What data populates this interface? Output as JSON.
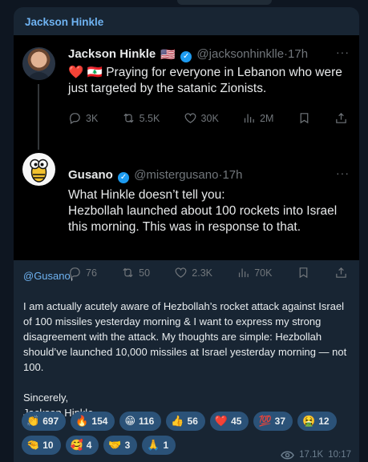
{
  "message": {
    "author": "Jackson Hinkle",
    "tweets": [
      {
        "name": "Jackson Hinkle",
        "flag": "🇺🇸",
        "handle": "@jacksonhinklle",
        "dot": "·",
        "time": "17h",
        "text": "❤️ 🇱🇧 Praying for everyone in Lebanon who were just targeted by the satanic Zionists.",
        "stats": {
          "replies": "3K",
          "retweets": "5.5K",
          "likes": "30K",
          "views": "2M"
        }
      },
      {
        "name": "Gusano",
        "handle": "@mistergusano",
        "dot": "·",
        "time": "17h",
        "text": "What Hinkle doesn’t tell you:\nHezbollah launched about 100 rockets into Israel this morning. This was in response to that.",
        "stats": {
          "replies": "76",
          "retweets": "50",
          "likes": "2.3K",
          "views": "70K"
        }
      }
    ],
    "mention": "@Gusano",
    "mention_suffix": ",",
    "paragraph": "I am actually acutely aware of Hezbollah’s rocket attack against Israel of 100 missiles yesterday morning & I want to express my strong disagreement with the attack. My thoughts are simple: Hezbollah should’ve launched 10,000 missiles at Israel yesterday morning — not 100.",
    "signoff": "Sincerely,",
    "signature": "Jackson Hinkle",
    "reactions": [
      {
        "emoji": "👏",
        "count": "697"
      },
      {
        "emoji": "🔥",
        "count": "154"
      },
      {
        "emoji": "😁",
        "count": "116"
      },
      {
        "emoji": "👍",
        "count": "56"
      },
      {
        "emoji": "❤️",
        "count": "45"
      },
      {
        "emoji": "💯",
        "count": "37"
      },
      {
        "emoji": "🤮",
        "count": "12"
      },
      {
        "emoji": "🤏",
        "count": "10"
      },
      {
        "emoji": "🥰",
        "count": "4"
      },
      {
        "emoji": "🤝",
        "count": "3"
      },
      {
        "emoji": "🙏",
        "count": "1"
      }
    ],
    "views": "17.1K",
    "time": "10:17"
  },
  "icons": {
    "verified": "verified-badge-icon",
    "more": "more-icon",
    "reply": "reply-icon",
    "retweet": "retweet-icon",
    "like": "like-icon",
    "views": "views-chart-icon",
    "bookmark": "bookmark-icon",
    "share": "share-icon",
    "eye": "eye-icon"
  },
  "colors": {
    "background": "#0e1621",
    "bubble": "#182533",
    "author": "#6fb3f2",
    "reaction": "#2b5278",
    "verified": "#1d9bf0"
  }
}
